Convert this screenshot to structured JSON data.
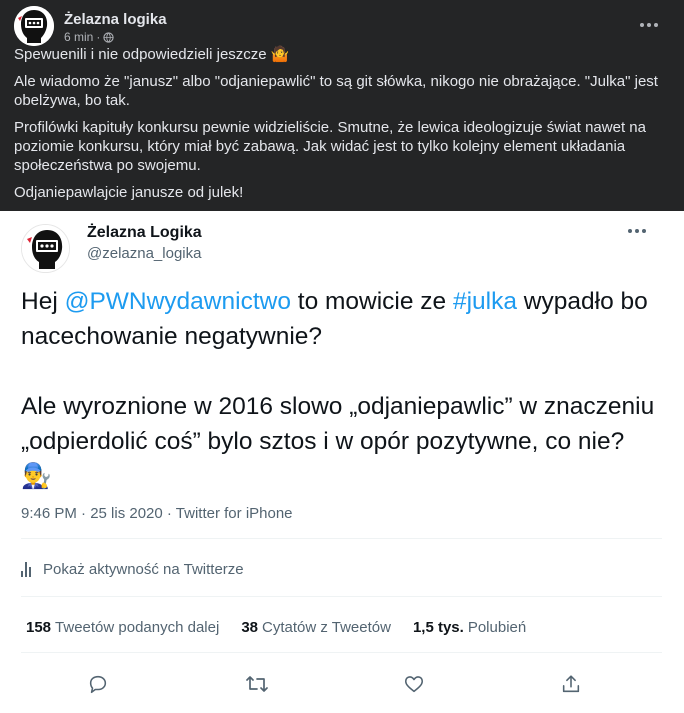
{
  "post": {
    "author": "Żelazna logika",
    "time": "6 min",
    "separator": "·",
    "paragraphs": [
      "Spewuenili i nie odpowiedzieli jeszcze 🤷",
      "Ale wiadomo że \"janusz\" albo \"odjaniepawlić\" to są git słówka, nikogo nie obrażające. \"Julka\" jest obelżywa, bo tak.",
      "Profilówki kapituły konkursu pewnie widzieliście. Smutne, że lewica ideologizuje świat nawet na poziomie konkursu, który miał być zabawą. Jak widać jest to tylko kolejny element układania społeczeństwa po swojemu.",
      "Odjaniepawlajcie janusze od julek!"
    ],
    "avatar_caption": "ŻELAZNA"
  },
  "tweet": {
    "name": "Żelazna Logika",
    "handle": "@zelazna_logika",
    "avatar_caption": "ŻELAZNA LOGIKA",
    "body": {
      "p1_prefix": "Hej ",
      "mention": "@PWNwydawnictwo",
      "p1_mid": " to mowicie ze ",
      "hashtag": "#julka",
      "p1_suffix": " wypadło bo nacechowanie negatywnie?",
      "p2": "Ale wyroznione w 2016 slowo „odjaniepawlic” w znaczeniu „odpierdolić coś” bylo sztos i w opór pozytywne, co nie? 👨‍🔧"
    },
    "timestamp": "9:46 PM · 25 lis 2020 · Twitter for iPhone",
    "activity_label": "Pokaż aktywność na Twitterze",
    "stats": [
      {
        "count": "158",
        "label": "Tweetów podanych dalej"
      },
      {
        "count": "38",
        "label": "Cytatów z Tweetów"
      },
      {
        "count": "1,5 tys.",
        "label": "Polubień"
      }
    ],
    "actions": [
      "reply-icon",
      "retweet-icon",
      "like-icon",
      "share-icon"
    ]
  },
  "colors": {
    "fb_bg": "#242526",
    "fb_text": "#e4e6eb",
    "fb_secondary": "#b0b3b8",
    "tw_link": "#1d9bf0",
    "tw_secondary": "#536471"
  }
}
